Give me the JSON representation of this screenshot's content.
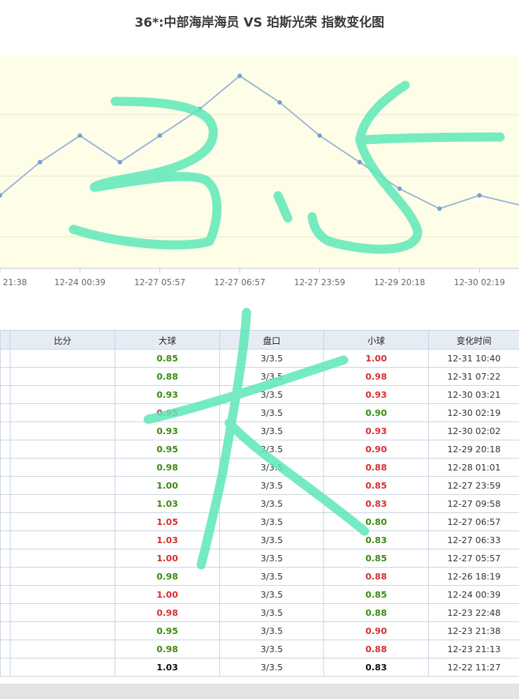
{
  "title": "36*:中部海岸海员 VS 珀斯光荣 指数变化图",
  "chart_data": {
    "type": "line",
    "x": [
      "12-23 21:38",
      "12-24 00:39",
      "12-26 18:19",
      "12-27 05:57",
      "12-27 06:33",
      "12-27 06:57",
      "12-27 09:58",
      "12-27 23:59",
      "12-28 01:01",
      "12-29 20:18",
      "12-30 02:02",
      "12-30 02:19",
      "12-30 03:21"
    ],
    "x_tick_labels": [
      "21:38",
      "12-24 00:39",
      "12-27 05:57",
      "12-27 06:57",
      "12-27 23:59",
      "12-29 20:18",
      "12-30 02:19"
    ],
    "series": [
      {
        "values": [
          0.95,
          1.0,
          1.04,
          1.0,
          1.04,
          1.08,
          1.13,
          1.09,
          1.04,
          1.0,
          0.96,
          0.93,
          0.95
        ]
      }
    ],
    "grid": true,
    "line_color": "#9ab5d8",
    "background": "#fdfde8"
  },
  "table": {
    "headers": [
      "",
      "比分",
      "大球",
      "盘口",
      "小球",
      "变化时间"
    ],
    "rows": [
      {
        "over": "0.85",
        "over_color": "green",
        "line": "3/3.5",
        "under": "1.00",
        "under_color": "red",
        "time": "12-31 10:40"
      },
      {
        "over": "0.88",
        "over_color": "green",
        "line": "3/3.5",
        "under": "0.98",
        "under_color": "red",
        "time": "12-31 07:22"
      },
      {
        "over": "0.93",
        "over_color": "green",
        "line": "3/3.5",
        "under": "0.93",
        "under_color": "red",
        "time": "12-30 03:21"
      },
      {
        "over": "0.95",
        "over_color": "red",
        "line": "3/3.5",
        "under": "0.90",
        "under_color": "green",
        "time": "12-30 02:19"
      },
      {
        "over": "0.93",
        "over_color": "green",
        "line": "3/3.5",
        "under": "0.93",
        "under_color": "red",
        "time": "12-30 02:02"
      },
      {
        "over": "0.95",
        "over_color": "green",
        "line": "3/3.5",
        "under": "0.90",
        "under_color": "red",
        "time": "12-29 20:18"
      },
      {
        "over": "0.98",
        "over_color": "green",
        "line": "3/3.5",
        "under": "0.88",
        "under_color": "red",
        "time": "12-28 01:01"
      },
      {
        "over": "1.00",
        "over_color": "green",
        "line": "3/3.5",
        "under": "0.85",
        "under_color": "red",
        "time": "12-27 23:59"
      },
      {
        "over": "1.03",
        "over_color": "green",
        "line": "3/3.5",
        "under": "0.83",
        "under_color": "red",
        "time": "12-27 09:58"
      },
      {
        "over": "1.05",
        "over_color": "red",
        "line": "3/3.5",
        "under": "0.80",
        "under_color": "green",
        "time": "12-27 06:57"
      },
      {
        "over": "1.03",
        "over_color": "red",
        "line": "3/3.5",
        "under": "0.83",
        "under_color": "green",
        "time": "12-27 06:33"
      },
      {
        "over": "1.00",
        "over_color": "red",
        "line": "3/3.5",
        "under": "0.85",
        "under_color": "green",
        "time": "12-27 05:57"
      },
      {
        "over": "0.98",
        "over_color": "green",
        "line": "3/3.5",
        "under": "0.88",
        "under_color": "red",
        "time": "12-26 18:19"
      },
      {
        "over": "1.00",
        "over_color": "red",
        "line": "3/3.5",
        "under": "0.85",
        "under_color": "green",
        "time": "12-24 00:39"
      },
      {
        "over": "0.98",
        "over_color": "red",
        "line": "3/3.5",
        "under": "0.88",
        "under_color": "green",
        "time": "12-23 22:48"
      },
      {
        "over": "0.95",
        "over_color": "green",
        "line": "3/3.5",
        "under": "0.90",
        "under_color": "red",
        "time": "12-23 21:38"
      },
      {
        "over": "0.98",
        "over_color": "green",
        "line": "3/3.5",
        "under": "0.88",
        "under_color": "red",
        "time": "12-23 21:13"
      },
      {
        "over": "1.03",
        "over_color": "black",
        "line": "3/3.5",
        "under": "0.83",
        "under_color": "black",
        "time": "12-22 11:27"
      }
    ]
  },
  "handwriting": {
    "text": "3.5 大",
    "color": "#5ee8b8"
  }
}
